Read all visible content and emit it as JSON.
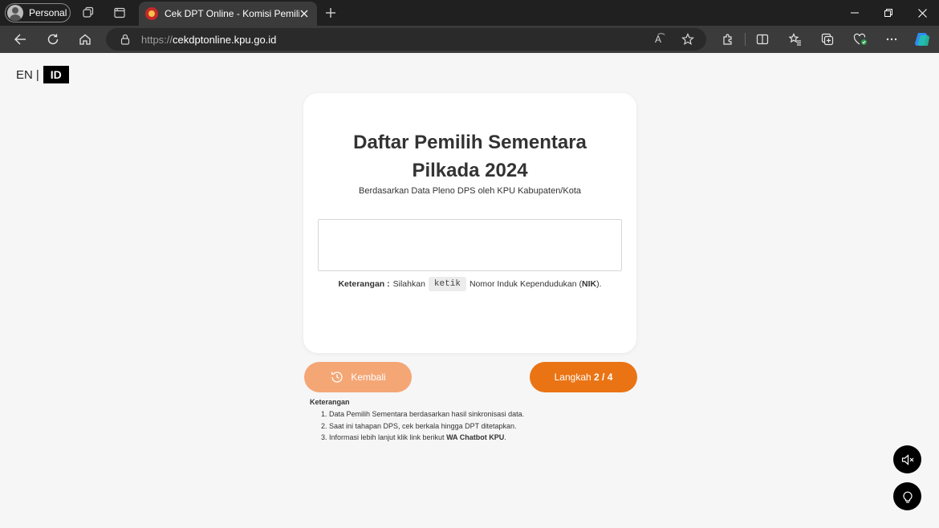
{
  "browser": {
    "profile_label": "Personal",
    "tab_title": "Cek DPT Online - Komisi Pemilihan Umum",
    "url_scheme": "https://",
    "url_host": "cekdptonline.kpu.go.id",
    "read_aloud_label": "A͡"
  },
  "page": {
    "lang_en": "EN",
    "lang_sep": "|",
    "lang_id": "ID",
    "title": "Daftar Pemilih Sementara Pilkada 2024",
    "subtitle": "Berdasarkan Data Pleno DPS oleh KPU Kabupaten/Kota",
    "nik_input_value": "",
    "note_label": "Keterangan :",
    "note_pre": "Silahkan",
    "note_kbd": "ketik",
    "note_mid": "Nomor Induk Kependudukan (",
    "note_bold": "NIK",
    "note_post": ").",
    "back_button": "Kembali",
    "next_button_prefix": "Langkah",
    "next_button_step": "2 / 4",
    "info_title": "Keterangan",
    "info_items": [
      "Data Pemilih Sementara berdasarkan hasil sinkronisasi data.",
      "Saat ini tahapan DPS, cek berkala hingga DPT ditetapkan."
    ],
    "info_item3_pre": "Informasi lebih lanjut klik link berikut ",
    "info_item3_link": "WA Chatbot KPU",
    "info_item3_post": "."
  },
  "colors": {
    "accent": "#ea7414",
    "accent_light": "#f4a675"
  }
}
